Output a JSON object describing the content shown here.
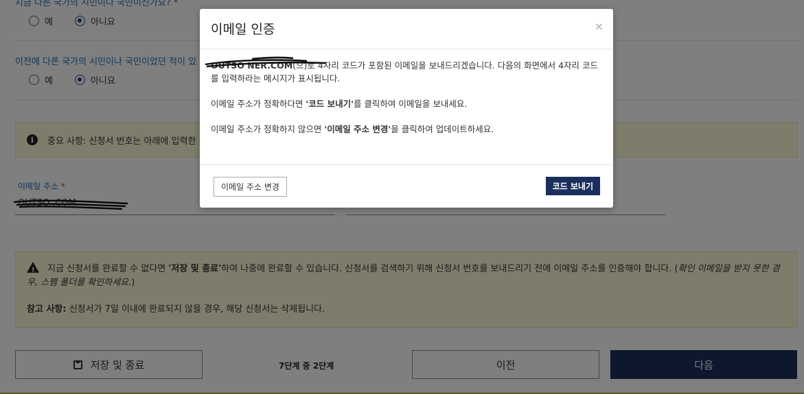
{
  "form": {
    "q1": {
      "label": "지금 다른 국가의 시민이나 국민이신가요?",
      "required_mark": "*",
      "options": [
        "예",
        "아니요"
      ],
      "selected": "아니요"
    },
    "q2": {
      "label": "이전에 다른 국가의 시민이나 국민이었던 적이 있",
      "options": [
        "예",
        "아니요"
      ],
      "selected": "아니요"
    },
    "notice_important": "중요 사항: 신청서 번호는 아래에 입력한",
    "email_field": {
      "label": "이메일 주소",
      "required_mark": "*",
      "value": "OUTSO                    .COM"
    },
    "notice_warning": {
      "text_before": "지금 신청서를 완료할 수 없다면 ",
      "bold": "'저장 및 종료'",
      "text_after": "하여 나중에 완료할 수 있습니다. 신청서를 검색하기 위해 신청서 번호를 보내드리기 전에 이메일 주소를 인증해야 합니다. (",
      "italic": "확인 이메일을 받지 못한 경우, 스팸 폴더를 확인하세요.",
      "close_paren": ")",
      "note_bold": "참고 사항:",
      "note_text": " 신청서가 7일 이내에 완료되지 않을 경우, 해당 신청서는 삭제됩니다."
    },
    "footer": {
      "save_label": "저장 및 종료",
      "step_label": "7단계 중 2단계",
      "prev_label": "이전",
      "next_label": "다음"
    }
  },
  "modal": {
    "title": "이메일 인증",
    "close": "×",
    "email_masked": "OUTSO          NER.COM",
    "p1_after_email": "(으)로 4자리 코드가 포함된 이메일을 보내드리겠습니다. 다음의 화면에서 4자리 코드를 입력하라는 메시지가 표시됩니다.",
    "p2_before": "이메일 주소가 정확하다면 ",
    "p2_bold": "'코드 보내기'",
    "p2_after": "를 클릭하여 이메일을 보내세요.",
    "p3_before": "이메일 주소가 정확하지 않으면 ",
    "p3_bold": "'이메일 주소 변경'",
    "p3_after": "을 클릭하여 업데이트하세요.",
    "change_email_label": "이메일 주소 변경",
    "send_code_label": "코드 보내기"
  },
  "colors": {
    "primary_navy": "#1a2f5c",
    "link_blue": "#1f6fb5",
    "notice_bg": "#fcf8d6",
    "required_red": "#c0392b"
  }
}
